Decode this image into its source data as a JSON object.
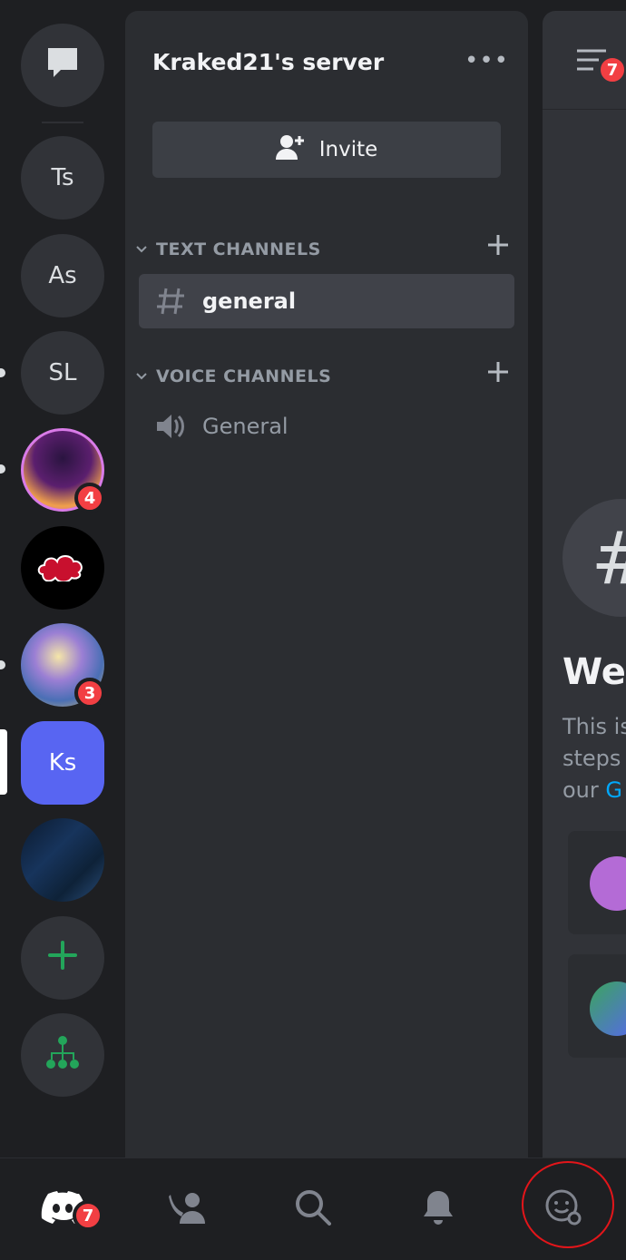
{
  "rail": {
    "servers": [
      {
        "id": "ts",
        "label": "Ts"
      },
      {
        "id": "as",
        "label": "As"
      },
      {
        "id": "sl",
        "label": "SL"
      },
      {
        "id": "ks",
        "label": "Ks"
      }
    ],
    "badges": {
      "purple_server": "4",
      "anime_server": "3"
    },
    "colors": {
      "active": "#5865f2",
      "add": "#23a55a",
      "mention": "#f23f43"
    }
  },
  "server": {
    "name": "Kraked21's server",
    "more_label": "•••",
    "invite_label": "Invite",
    "categories": [
      {
        "label": "TEXT CHANNELS",
        "channels": [
          {
            "name": "general",
            "type": "text",
            "selected": true
          }
        ]
      },
      {
        "label": "VOICE CHANNELS",
        "channels": [
          {
            "name": "General",
            "type": "voice",
            "selected": false
          }
        ]
      }
    ]
  },
  "main": {
    "members_badge": "7",
    "hash_glyph": "#",
    "welcome_text": "Wel",
    "description_lines": [
      "This is",
      "steps",
      "our "
    ],
    "link_text": "G"
  },
  "tabbar": {
    "home_badge": "7",
    "tabs": [
      "home",
      "friends",
      "search",
      "notifications",
      "you"
    ],
    "highlight_color": "#e3151a"
  }
}
